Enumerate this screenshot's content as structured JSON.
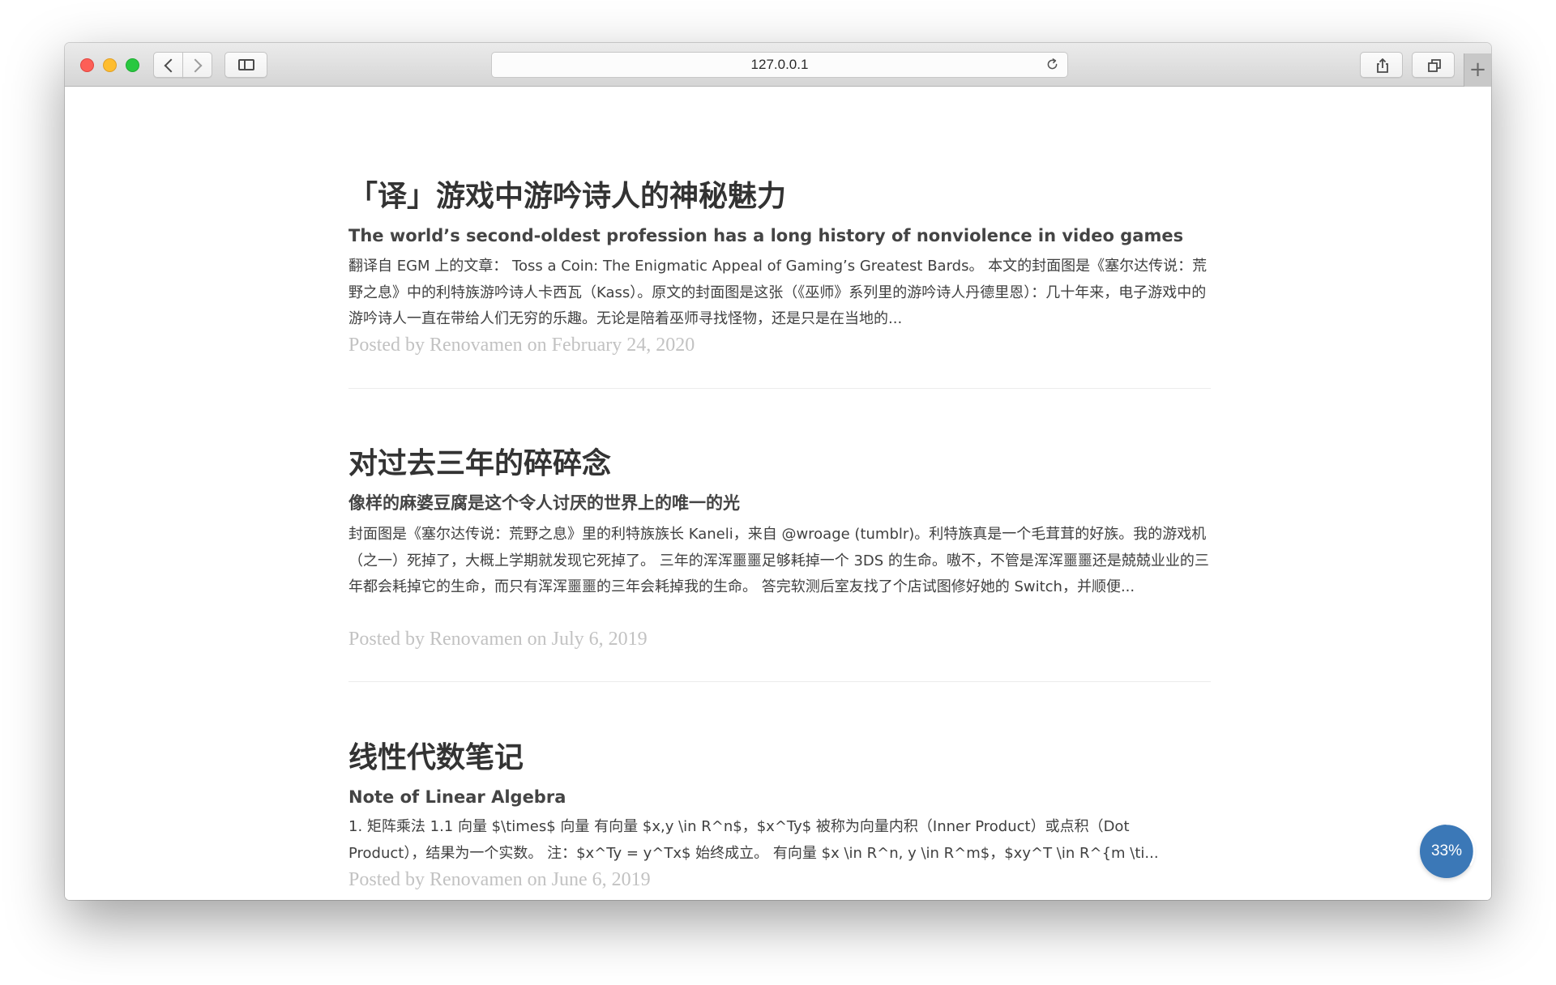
{
  "browser": {
    "url": "127.0.0.1",
    "new_tab_label": "+"
  },
  "posts": [
    {
      "title": "「译」游戏中游吟诗人的神秘魅力",
      "subtitle": "The world’s second-oldest profession has a long history of nonviolence in video games",
      "excerpt": "翻译自 EGM 上的文章： Toss a Coin: The Enigmatic Appeal of Gaming’s Greatest Bards。 本文的封面图是《塞尔达传说：荒野之息》中的利特族游吟诗人卡西瓦（Kass）。原文的封面图是这张（《巫师》系列里的游吟诗人丹德里恩）：几十年来，电子游戏中的游吟诗人一直在带给人们无穷的乐趣。无论是陪着巫师寻找怪物，还是只是在当地的...",
      "meta": "Posted by Renovamen on February 24, 2020"
    },
    {
      "title": "对过去三年的碎碎念",
      "subtitle": "像样的麻婆豆腐是这个令人讨厌的世界上的唯一的光",
      "excerpt": "封面图是《塞尔达传说：荒野之息》里的利特族族长 Kaneli，来自 @wroage (tumblr)。利特族真是一个毛茸茸的好族。我的游戏机（之一）死掉了，大概上学期就发现它死掉了。 三年的浑浑噩噩足够耗掉一个 3DS 的生命。嗷不，不管是浑浑噩噩还是兢兢业业的三年都会耗掉它的生命，而只有浑浑噩噩的三年会耗掉我的生命。 答完软测后室友找了个店试图修好她的 Switch，并顺便...",
      "meta": "Posted by Renovamen on July 6, 2019"
    },
    {
      "title": "线性代数笔记",
      "subtitle": "Note of Linear Algebra",
      "excerpt": "1. 矩阵乘法 1.1 向量 $\\times$ 向量 有向量 $x,y \\in R^n$，$x^Ty$ 被称为向量内积（Inner Product）或点积（Dot Product），结果为一个实数。 注：$x^Ty = y^Tx$ 始终成立。 有向量 $x \\in R^n, y \\in R^m$，$xy^T \\in R^{m \\ti...",
      "meta": "Posted by Renovamen on June 6, 2019"
    }
  ],
  "reading_progress": {
    "label": "33%",
    "value": 0.33
  }
}
